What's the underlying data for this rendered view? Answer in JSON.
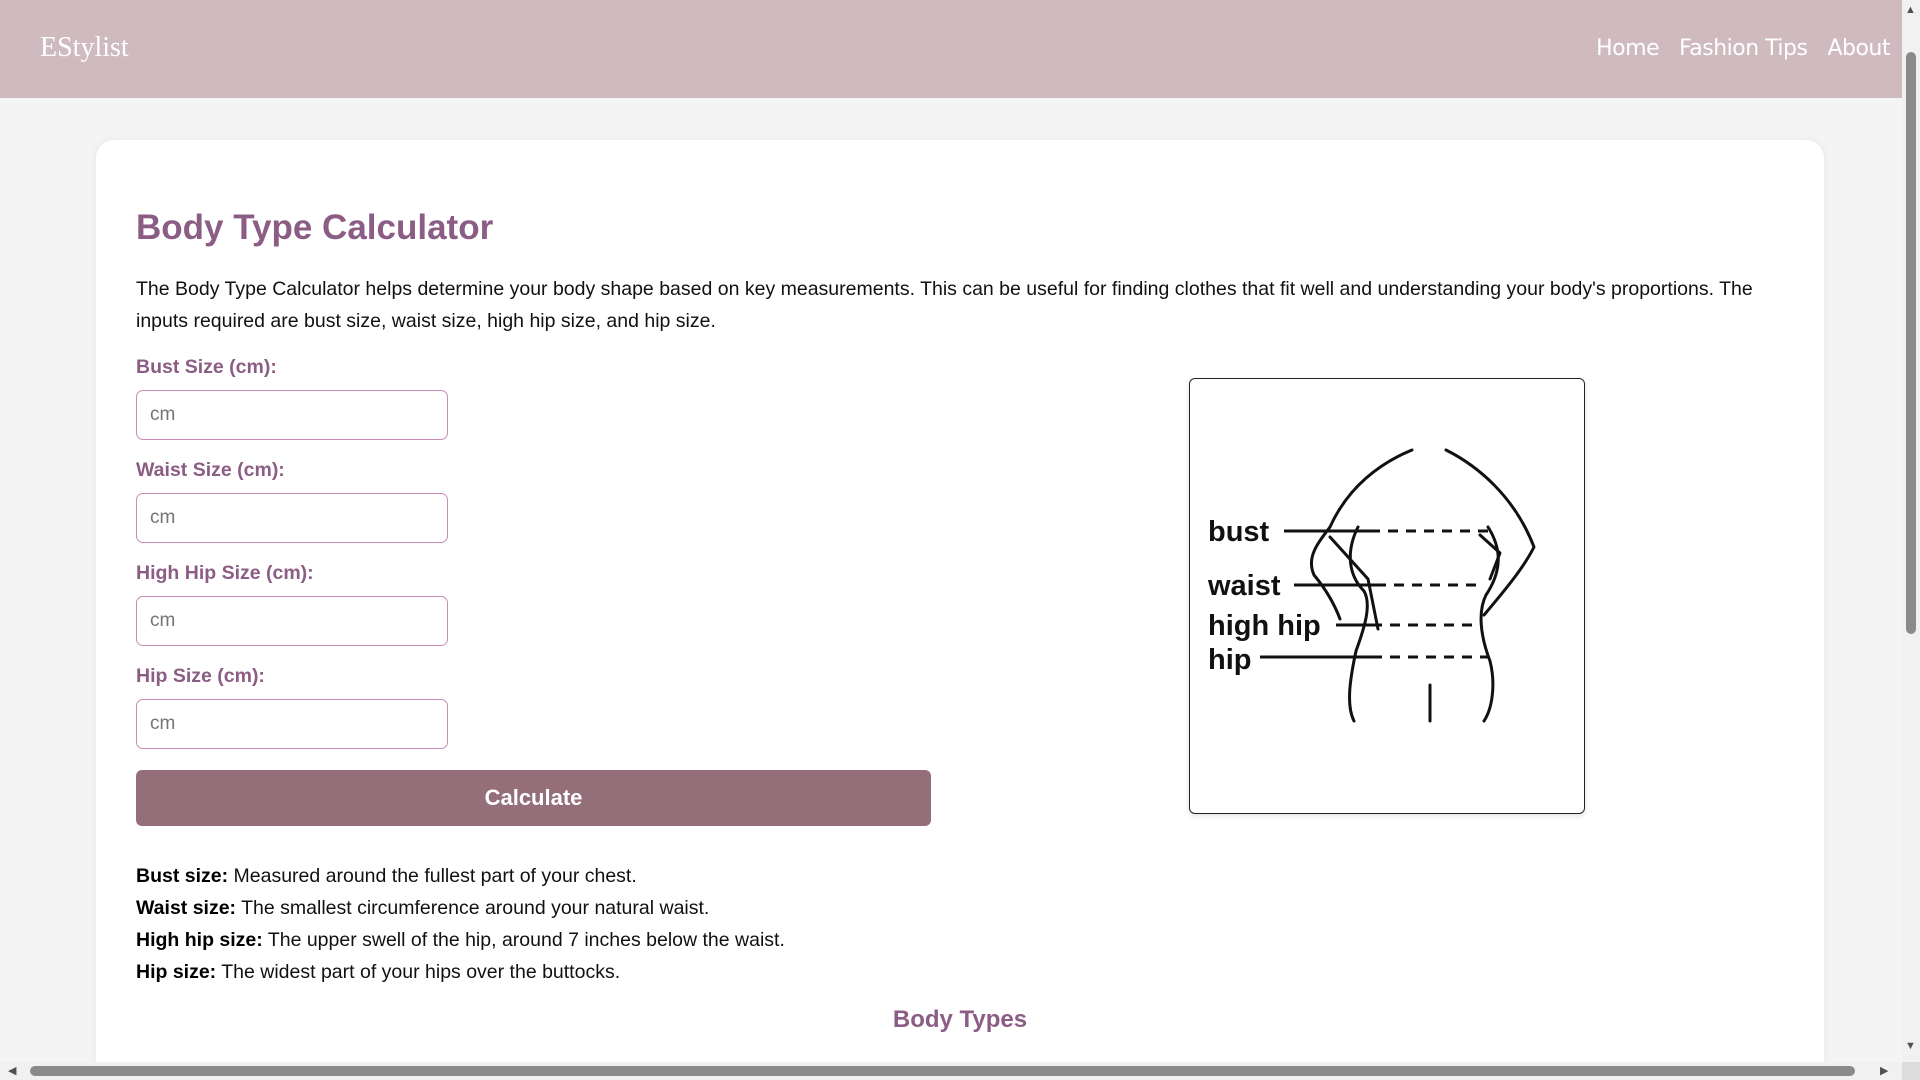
{
  "header": {
    "brand": "EStylist",
    "nav": [
      "Home",
      "Fashion Tips",
      "About"
    ]
  },
  "calculator": {
    "title": "Body Type Calculator",
    "intro": "The Body Type Calculator helps determine your body shape based on key measurements. This can be useful for finding clothes that fit well and understanding your body's proportions. The inputs required are bust size, waist size, high hip size, and hip size.",
    "fields": [
      {
        "label": "Bust Size (cm):",
        "placeholder": "cm",
        "value": ""
      },
      {
        "label": "Waist Size (cm):",
        "placeholder": "cm",
        "value": ""
      },
      {
        "label": "High Hip Size (cm):",
        "placeholder": "cm",
        "value": ""
      },
      {
        "label": "Hip Size (cm):",
        "placeholder": "cm",
        "value": ""
      }
    ],
    "button_label": "Calculate",
    "definitions": [
      {
        "term": "Bust size:",
        "text": " Measured around the fullest part of your chest."
      },
      {
        "term": "Waist size:",
        "text": " The smallest circumference around your natural waist."
      },
      {
        "term": "High hip size:",
        "text": " The upper swell of the hip, around 7 inches below the waist."
      },
      {
        "term": "Hip size:",
        "text": " The widest part of your hips over the buttocks."
      }
    ],
    "diagram_labels": [
      "bust",
      "waist",
      "high hip",
      "hip"
    ],
    "section_title": "Body Types"
  },
  "colors": {
    "header_bg": "#cfbbbf",
    "accent": "#8c5d84",
    "button_bg": "#946f79",
    "input_border": "#c98cb5"
  },
  "icons": {
    "scroll_up": "triangle-up-icon",
    "scroll_down": "triangle-down-icon",
    "scroll_left": "triangle-left-icon",
    "scroll_right": "triangle-right-icon"
  }
}
